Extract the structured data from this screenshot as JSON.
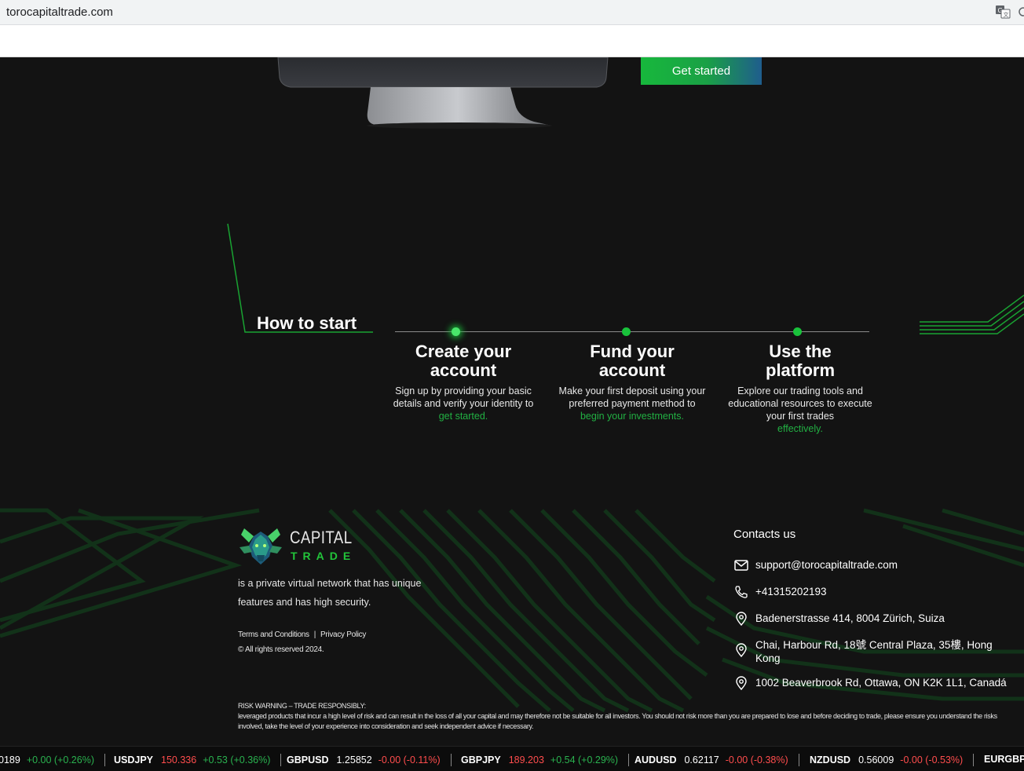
{
  "browser": {
    "url": "torocapitaltrade.com"
  },
  "hero": {
    "cta_label": "Get started"
  },
  "how_to_start": {
    "title": "How to start",
    "steps": [
      {
        "title_line1": "Create your",
        "title_line2": "account",
        "desc": "Sign up by providing your basic details and verify your identity to",
        "link": "get started."
      },
      {
        "title_line1": "Fund your",
        "title_line2": "account",
        "desc": "Make your first deposit using your preferred payment method to",
        "link": "begin your investments."
      },
      {
        "title_line1": "Use the",
        "title_line2": "platform",
        "desc": "Explore our trading tools and educational resources to execute your first trades",
        "link": "effectively."
      }
    ]
  },
  "footer": {
    "logo": {
      "top": "CAPITAL",
      "bottom": "TRADE"
    },
    "tagline": "is a private virtual network that has unique features and has high security.",
    "terms": "Terms and Conditions",
    "privacy": "Privacy Policy",
    "separator": "|",
    "copyright": "© All rights reserved 2024.",
    "contacts_title": "Contacts us",
    "contacts": [
      {
        "icon": "mail-icon",
        "text": "support@torocapitaltrade.com"
      },
      {
        "icon": "phone-icon",
        "text": "+41315202193"
      },
      {
        "icon": "location-icon",
        "text": "Badenerstrasse 414, 8004 Zürich, Suiza"
      },
      {
        "icon": "location-icon",
        "text": "Chai, Harbour Rd, 18號 Central Plaza, 35樓, Hong Kong"
      },
      {
        "icon": "location-icon",
        "text": "1002 Beaverbrook Rd, Ottawa, ON K2K 1L1, Canadá"
      }
    ],
    "risk_title": "RISK WARNING – TRADE RESPONSIBLY:",
    "risk_text": "leveraged products that incur a high level of risk and can result in the loss of all your capital and may therefore not be suitable for all investors. You should not risk more than you are prepared to lose and before deciding to trade, please ensure you understand the risks involved, take the level of your experience into consideration and seek independent advice if necessary."
  },
  "ticker": [
    {
      "symbol": "",
      "price": "0189",
      "price_dir": "up",
      "change": "+0.00 (+0.26%)",
      "change_dir": "up"
    },
    {
      "symbol": "USDJPY",
      "price": "150.336",
      "price_dir": "down",
      "change": "+0.53 (+0.36%)",
      "change_dir": "up"
    },
    {
      "symbol": "GBPUSD",
      "price": "1.25852",
      "price_dir": "up",
      "change": "-0.00 (-0.11%)",
      "change_dir": "down"
    },
    {
      "symbol": "GBPJPY",
      "price": "189.203",
      "price_dir": "down",
      "change": "+0.54 (+0.29%)",
      "change_dir": "up"
    },
    {
      "symbol": "AUDUSD",
      "price": "0.62117",
      "price_dir": "up",
      "change": "-0.00 (-0.38%)",
      "change_dir": "down"
    },
    {
      "symbol": "NZDUSD",
      "price": "0.56009",
      "price_dir": "up",
      "change": "-0.00 (-0.53%)",
      "change_dir": "down"
    },
    {
      "symbol": "EURGBP",
      "price": "",
      "price_dir": "up",
      "change": "",
      "change_dir": "up"
    }
  ],
  "colors": {
    "accent_green": "#19c23b",
    "background": "#131313",
    "down_red": "#ff4d4d",
    "up_green": "#2ab24f"
  }
}
